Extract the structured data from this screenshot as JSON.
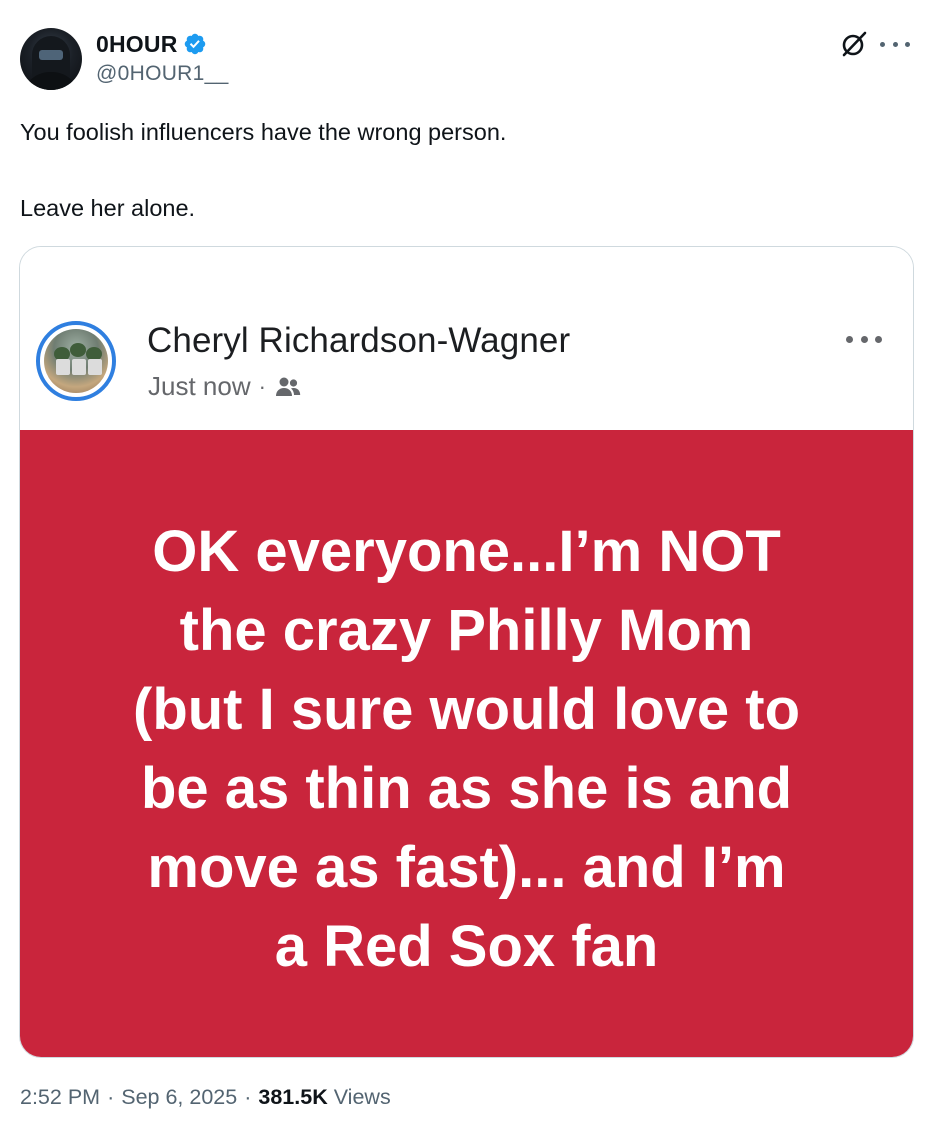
{
  "author": {
    "display_name": "0HOUR",
    "handle": "@0HOUR1__",
    "verified": true,
    "verified_color": "#1d9bf0"
  },
  "icons": {
    "header_actions": [
      "grok-icon",
      "more-icon"
    ]
  },
  "tweet": {
    "text_line_1": "You foolish influencers have the wrong person.",
    "text_line_2": "Leave her alone."
  },
  "embedded_post": {
    "name": "Cheryl Richardson-Wagner",
    "time": "Just now",
    "separator": "·",
    "audience_icon": "friends-icon",
    "background_color": "#c9253c",
    "text_lines": [
      "OK everyone...I’m NOT",
      "the crazy Philly Mom",
      "(but I sure would love to",
      "be as thin as she is and",
      "move as fast)... and I’m",
      "a Red Sox fan"
    ]
  },
  "meta": {
    "time": "2:52 PM",
    "date": "Sep 6, 2025",
    "separator": "·",
    "views_count": "381.5K",
    "views_label": "Views"
  }
}
